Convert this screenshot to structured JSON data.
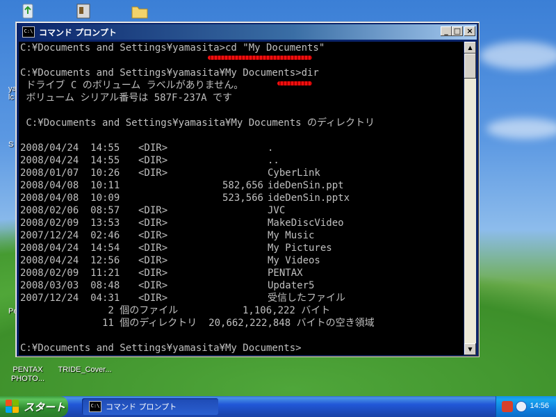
{
  "desktop": {
    "icons": [
      {
        "label": "PENTAX PHOTO..."
      },
      {
        "label": "TRIDE_Cover..."
      }
    ],
    "edge_chars": [
      "ya",
      "lc",
      "S",
      "Pe"
    ]
  },
  "window": {
    "title": "コマンド プロンプト",
    "icon_text": "C:\\",
    "controls": {
      "minimize": "_",
      "maximize": "□",
      "close": "×"
    }
  },
  "console": {
    "cmd1": "C:¥Documents and Settings¥yamasita>cd \"My Documents\"",
    "cmd2": "C:¥Documents and Settings¥yamasita¥My Documents>dir",
    "volume_label": " ドライブ C のボリューム ラベルがありません。",
    "volume_serial": " ボリューム シリアル番号は 587F-237A です",
    "dir_header": " C:¥Documents and Settings¥yamasita¥My Documents のディレクトリ",
    "entries": [
      {
        "date": "2008/04/24  14:55",
        "tag": "<DIR>",
        "size": "",
        "name": "."
      },
      {
        "date": "2008/04/24  14:55",
        "tag": "<DIR>",
        "size": "",
        "name": ".."
      },
      {
        "date": "2008/01/07  10:26",
        "tag": "<DIR>",
        "size": "",
        "name": "CyberLink"
      },
      {
        "date": "2008/04/08  10:11",
        "tag": "",
        "size": "582,656",
        "name": "ideDenSin.ppt"
      },
      {
        "date": "2008/04/08  10:09",
        "tag": "",
        "size": "523,566",
        "name": "ideDenSin.pptx"
      },
      {
        "date": "2008/02/06  08:57",
        "tag": "<DIR>",
        "size": "",
        "name": "JVC"
      },
      {
        "date": "2008/02/09  13:53",
        "tag": "<DIR>",
        "size": "",
        "name": "MakeDiscVideo"
      },
      {
        "date": "2007/12/24  02:46",
        "tag": "<DIR>",
        "size": "",
        "name": "My Music"
      },
      {
        "date": "2008/04/24  14:54",
        "tag": "<DIR>",
        "size": "",
        "name": "My Pictures"
      },
      {
        "date": "2008/04/24  12:56",
        "tag": "<DIR>",
        "size": "",
        "name": "My Videos"
      },
      {
        "date": "2008/02/09  11:21",
        "tag": "<DIR>",
        "size": "",
        "name": "PENTAX"
      },
      {
        "date": "2008/03/03  08:48",
        "tag": "<DIR>",
        "size": "",
        "name": "Updater5"
      },
      {
        "date": "2007/12/24  04:31",
        "tag": "<DIR>",
        "size": "",
        "name": "受信したファイル"
      }
    ],
    "summary_files": "               2 個のファイル           1,106,222 バイト",
    "summary_dirs": "              11 個のディレクトリ  20,662,222,848 バイトの空き領域",
    "prompt": "C:¥Documents and Settings¥yamasita¥My Documents>"
  },
  "taskbar": {
    "start_label": "スタート",
    "task_title": "コマンド プロンプト",
    "clock": "14:56"
  },
  "colors": {
    "console_bg": "#000000",
    "console_fg": "#c0c0c0",
    "annotation": "#ff1010"
  }
}
